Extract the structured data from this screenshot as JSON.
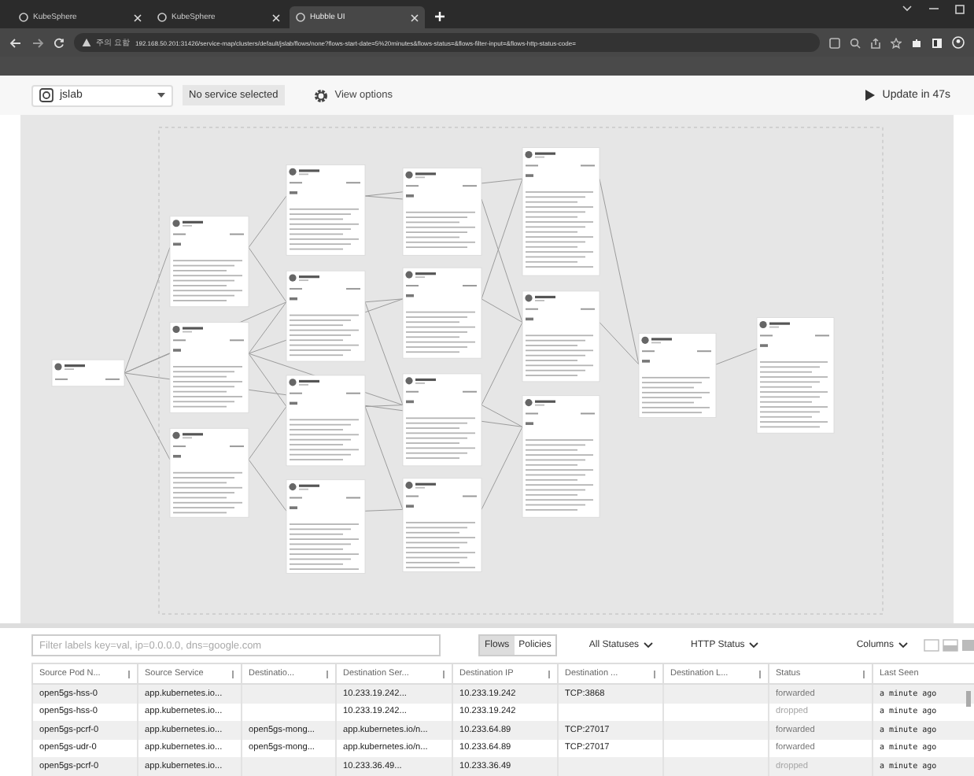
{
  "browser": {
    "tabs": [
      {
        "title": "KubeSphere",
        "selected": false
      },
      {
        "title": "KubeSphere",
        "selected": false
      },
      {
        "title": "Hubble UI",
        "selected": true
      }
    ],
    "security": "주의 요함",
    "address": "192.168.50.201:31426/service-map/clusters/default/jslab/flows/none?flows-start-date=5%20minutes&flows-status=&flows-filter-input=&flows-http-status-code="
  },
  "toolbar": {
    "namespace": "jslab",
    "service": "No service selected",
    "view_options": "View options",
    "update": "Update in 47s"
  },
  "filters": {
    "placeholder": "Filter labels key=val, ip=0.0.0.0, dns=google.com",
    "modes": [
      {
        "label": "Flows",
        "selected": true
      },
      {
        "label": "Policies",
        "selected": false
      }
    ],
    "dropdowns": [
      "All Statuses",
      "HTTP Status",
      "Columns"
    ]
  },
  "table": {
    "columns": [
      "Source Pod N...",
      "Source Service",
      "Destinatio...",
      "Destination Ser...",
      "Destination IP",
      "Destination ...",
      "Destination L...",
      "Status",
      "Last Seen"
    ],
    "rows": [
      {
        "cells": [
          "open5gs-hss-0",
          "app.kubernetes.io...",
          "",
          "10.233.19.242...",
          "10.233.19.242",
          "TCP:3868",
          "",
          "forwarded",
          "a minute ago"
        ],
        "dropped": false
      },
      {
        "cells": [
          "open5gs-hss-0",
          "app.kubernetes.io...",
          "",
          "10.233.19.242...",
          "10.233.19.242",
          "",
          "",
          "dropped",
          "a minute ago"
        ],
        "dropped": true
      },
      {
        "cells": [
          "open5gs-pcrf-0",
          "app.kubernetes.io...",
          "open5gs-mong...",
          "app.kubernetes.io/n...",
          "10.233.64.89",
          "TCP:27017",
          "",
          "forwarded",
          "a minute ago"
        ],
        "dropped": false
      },
      {
        "cells": [
          "open5gs-udr-0",
          "app.kubernetes.io...",
          "open5gs-mong...",
          "app.kubernetes.io/n...",
          "10.233.64.89",
          "TCP:27017",
          "",
          "forwarded",
          "a minute ago"
        ],
        "dropped": false
      },
      {
        "cells": [
          "open5gs-pcrf-0",
          "app.kubernetes.io...",
          "",
          "10.233.36.49...",
          "10.233.36.49",
          "",
          "",
          "dropped",
          "a minute ago"
        ],
        "dropped": true
      }
    ]
  }
}
